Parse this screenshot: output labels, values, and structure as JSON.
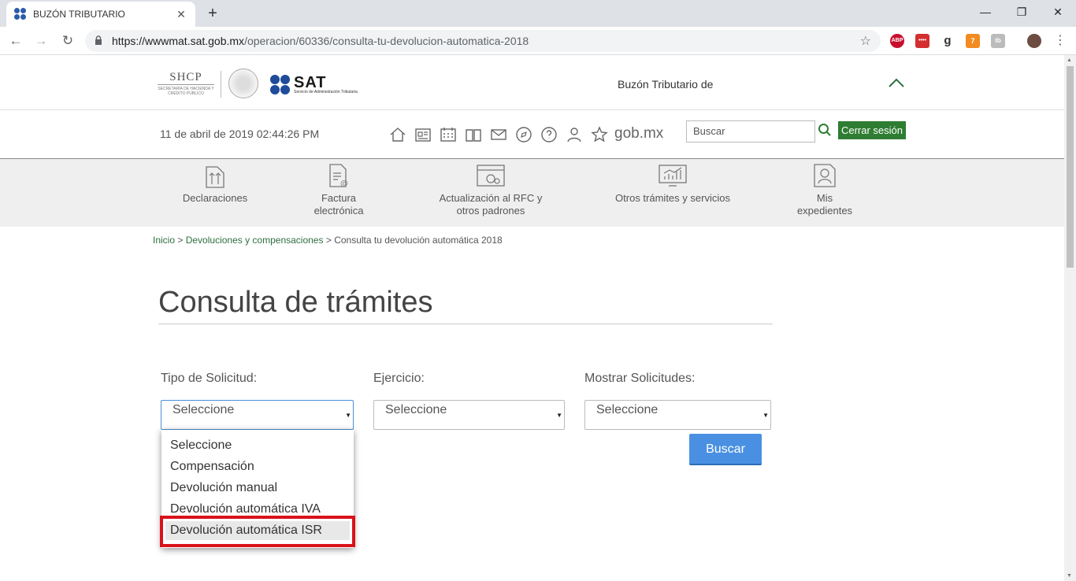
{
  "browser": {
    "tab_title": "BUZÓN TRIBUTARIO",
    "new_tab": "+",
    "url_host": "https://wwwmat.sat.gob.mx",
    "url_path": "/operacion/60336/consulta-tu-devolucion-automatica-2018",
    "extensions": [
      "ABP",
      "••••",
      "g",
      "7",
      "tb"
    ]
  },
  "header": {
    "shcp_logo": "SHCP",
    "shcp_sub": "SECRETARÍA DE HACIENDA Y CRÉDITO PÚBLICO",
    "sat_logo": "SAT",
    "sat_sub": "Servicio de Administración Tributaria",
    "buzon_label": "Buzón Tributario de",
    "datetime": "11 de abril de 2019 02:44:26 PM",
    "gobmx": "gob.mx",
    "search_placeholder": "Buscar",
    "logout": "Cerrar sesión"
  },
  "nav": {
    "items": [
      {
        "line1": "Declaraciones",
        "line2": ""
      },
      {
        "line1": "Factura",
        "line2": "electrónica"
      },
      {
        "line1": "Actualización al RFC y",
        "line2": "otros padrones"
      },
      {
        "line1": "Otros trámites y servicios",
        "line2": ""
      },
      {
        "line1": "Mis",
        "line2": "expedientes"
      }
    ]
  },
  "breadcrumb": {
    "inicio": "Inicio",
    "sep": ">",
    "devoluciones": "Devoluciones y compensaciones",
    "current": "Consulta tu devolución automática 2018"
  },
  "main": {
    "title": "Consulta de trámites",
    "fields": {
      "tipo_label": "Tipo de Solicitud:",
      "tipo_value": "Seleccione",
      "ejercicio_label": "Ejercicio:",
      "ejercicio_value": "Seleccione",
      "mostrar_label": "Mostrar Solicitudes:",
      "mostrar_value": "Seleccione"
    },
    "search_button": "Buscar",
    "dropdown_options": [
      "Seleccione",
      "Compensación",
      "Devolución manual",
      "Devolución automática IVA",
      "Devolución automática ISR"
    ],
    "highlight_color": "#d9121a"
  }
}
